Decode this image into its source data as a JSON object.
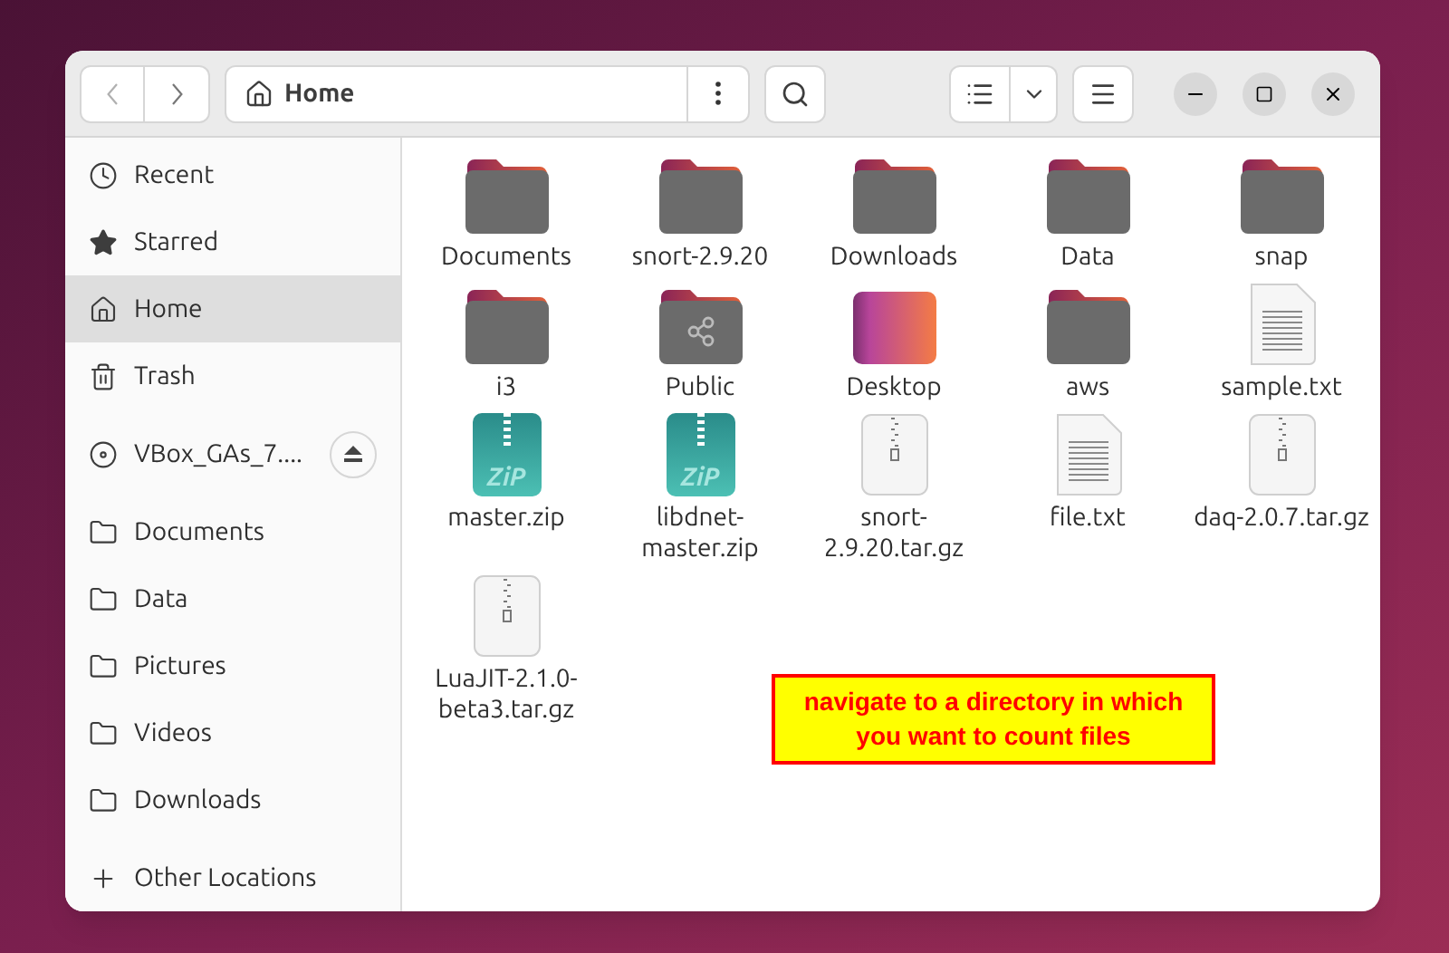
{
  "header": {
    "back_disabled": true,
    "location": "Home"
  },
  "sidebar": {
    "items": [
      {
        "label": "Recent",
        "kind": "recent",
        "selected": false
      },
      {
        "label": "Starred",
        "kind": "starred",
        "selected": false
      },
      {
        "label": "Home",
        "kind": "home",
        "selected": true
      },
      {
        "label": "Trash",
        "kind": "trash",
        "selected": false
      },
      {
        "label": "VBox_GAs_7....",
        "kind": "drive",
        "selected": false
      },
      {
        "label": "Documents",
        "kind": "bookmark",
        "selected": false
      },
      {
        "label": "Data",
        "kind": "bookmark",
        "selected": false
      },
      {
        "label": "Pictures",
        "kind": "bookmark",
        "selected": false
      },
      {
        "label": "Videos",
        "kind": "bookmark",
        "selected": false
      },
      {
        "label": "Downloads",
        "kind": "bookmark",
        "selected": false
      },
      {
        "label": "Other Locations",
        "kind": "other",
        "selected": false
      }
    ]
  },
  "files": [
    {
      "name": "Documents",
      "kind": "folder"
    },
    {
      "name": "snort-2.9.20",
      "kind": "folder"
    },
    {
      "name": "Downloads",
      "kind": "folder"
    },
    {
      "name": "Data",
      "kind": "folder"
    },
    {
      "name": "snap",
      "kind": "folder"
    },
    {
      "name": "i3",
      "kind": "folder"
    },
    {
      "name": "Public",
      "kind": "shared-folder"
    },
    {
      "name": "Desktop",
      "kind": "desktop"
    },
    {
      "name": "aws",
      "kind": "folder"
    },
    {
      "name": "sample.txt",
      "kind": "text"
    },
    {
      "name": "master.zip",
      "kind": "zip",
      "zip_label": "ZiP"
    },
    {
      "name": "libdnet-master.zip",
      "kind": "zip",
      "zip_label": "ZiP"
    },
    {
      "name": "snort-2.9.20.tar.gz",
      "kind": "archive"
    },
    {
      "name": "file.txt",
      "kind": "text"
    },
    {
      "name": "daq-2.0.7.tar.gz",
      "kind": "archive"
    },
    {
      "name": "LuaJIT-2.1.0-beta3.tar.gz",
      "kind": "archive"
    }
  ],
  "annotation": {
    "text": "navigate to a directory in which you want to count files"
  }
}
